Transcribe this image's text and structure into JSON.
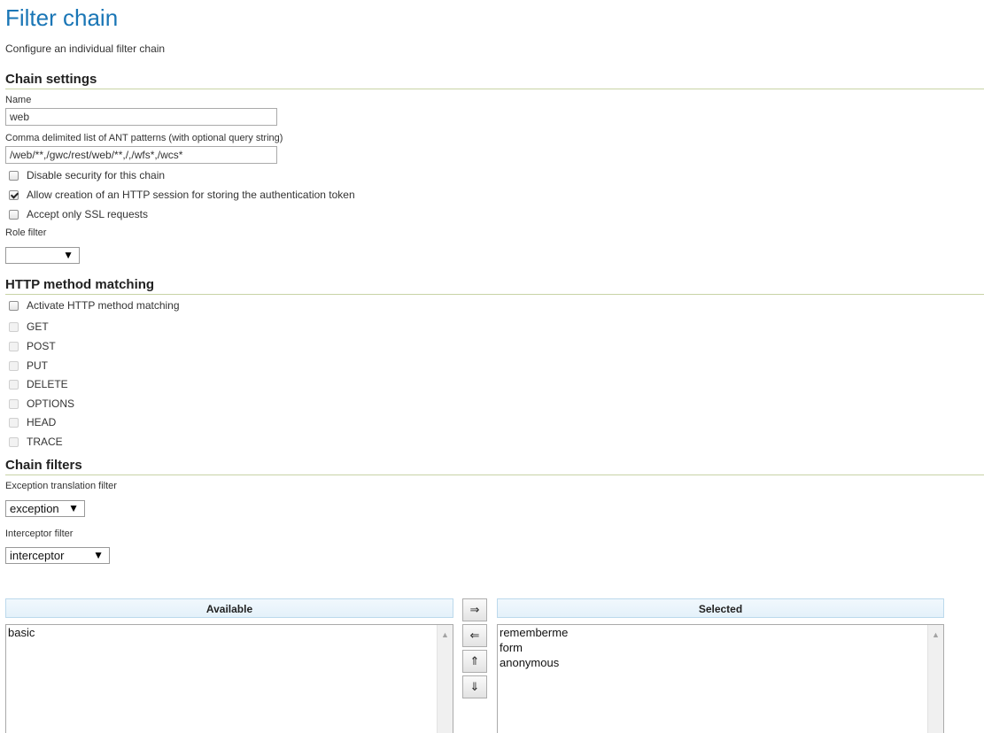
{
  "page": {
    "title": "Filter chain",
    "description": "Configure an individual filter chain"
  },
  "chain_settings": {
    "heading": "Chain settings",
    "name_label": "Name",
    "name_value": "web",
    "patterns_label": "Comma delimited list of ANT patterns (with optional query string)",
    "patterns_value": "/web/**,/gwc/rest/web/**,/,/wfs*,/wcs*",
    "disable_security_label": "Disable security for this chain",
    "disable_security_checked": false,
    "allow_session_label": "Allow creation of an HTTP session for storing the authentication token",
    "allow_session_checked": true,
    "ssl_only_label": "Accept only SSL requests",
    "ssl_only_checked": false,
    "role_filter_label": "Role filter",
    "role_filter_value": "",
    "dropdown_arrow": "▼"
  },
  "http_method_matching": {
    "heading": "HTTP method matching",
    "activate_label": "Activate HTTP method matching",
    "activate_checked": false,
    "methods": [
      "GET",
      "POST",
      "PUT",
      "DELETE",
      "OPTIONS",
      "HEAD",
      "TRACE"
    ]
  },
  "chain_filters": {
    "heading": "Chain filters",
    "exception_label": "Exception translation filter",
    "exception_value": "exception",
    "interceptor_label": "Interceptor filter",
    "interceptor_value": "interceptor",
    "available_header": "Available",
    "selected_header": "Selected",
    "available_items": [
      "basic"
    ],
    "selected_items": [
      "rememberme",
      "form",
      "anonymous"
    ],
    "move_buttons": {
      "add": "⇒",
      "remove": "⇐",
      "up": "⇑",
      "down": "⇓"
    },
    "scroll_up_glyph": "▲"
  }
}
